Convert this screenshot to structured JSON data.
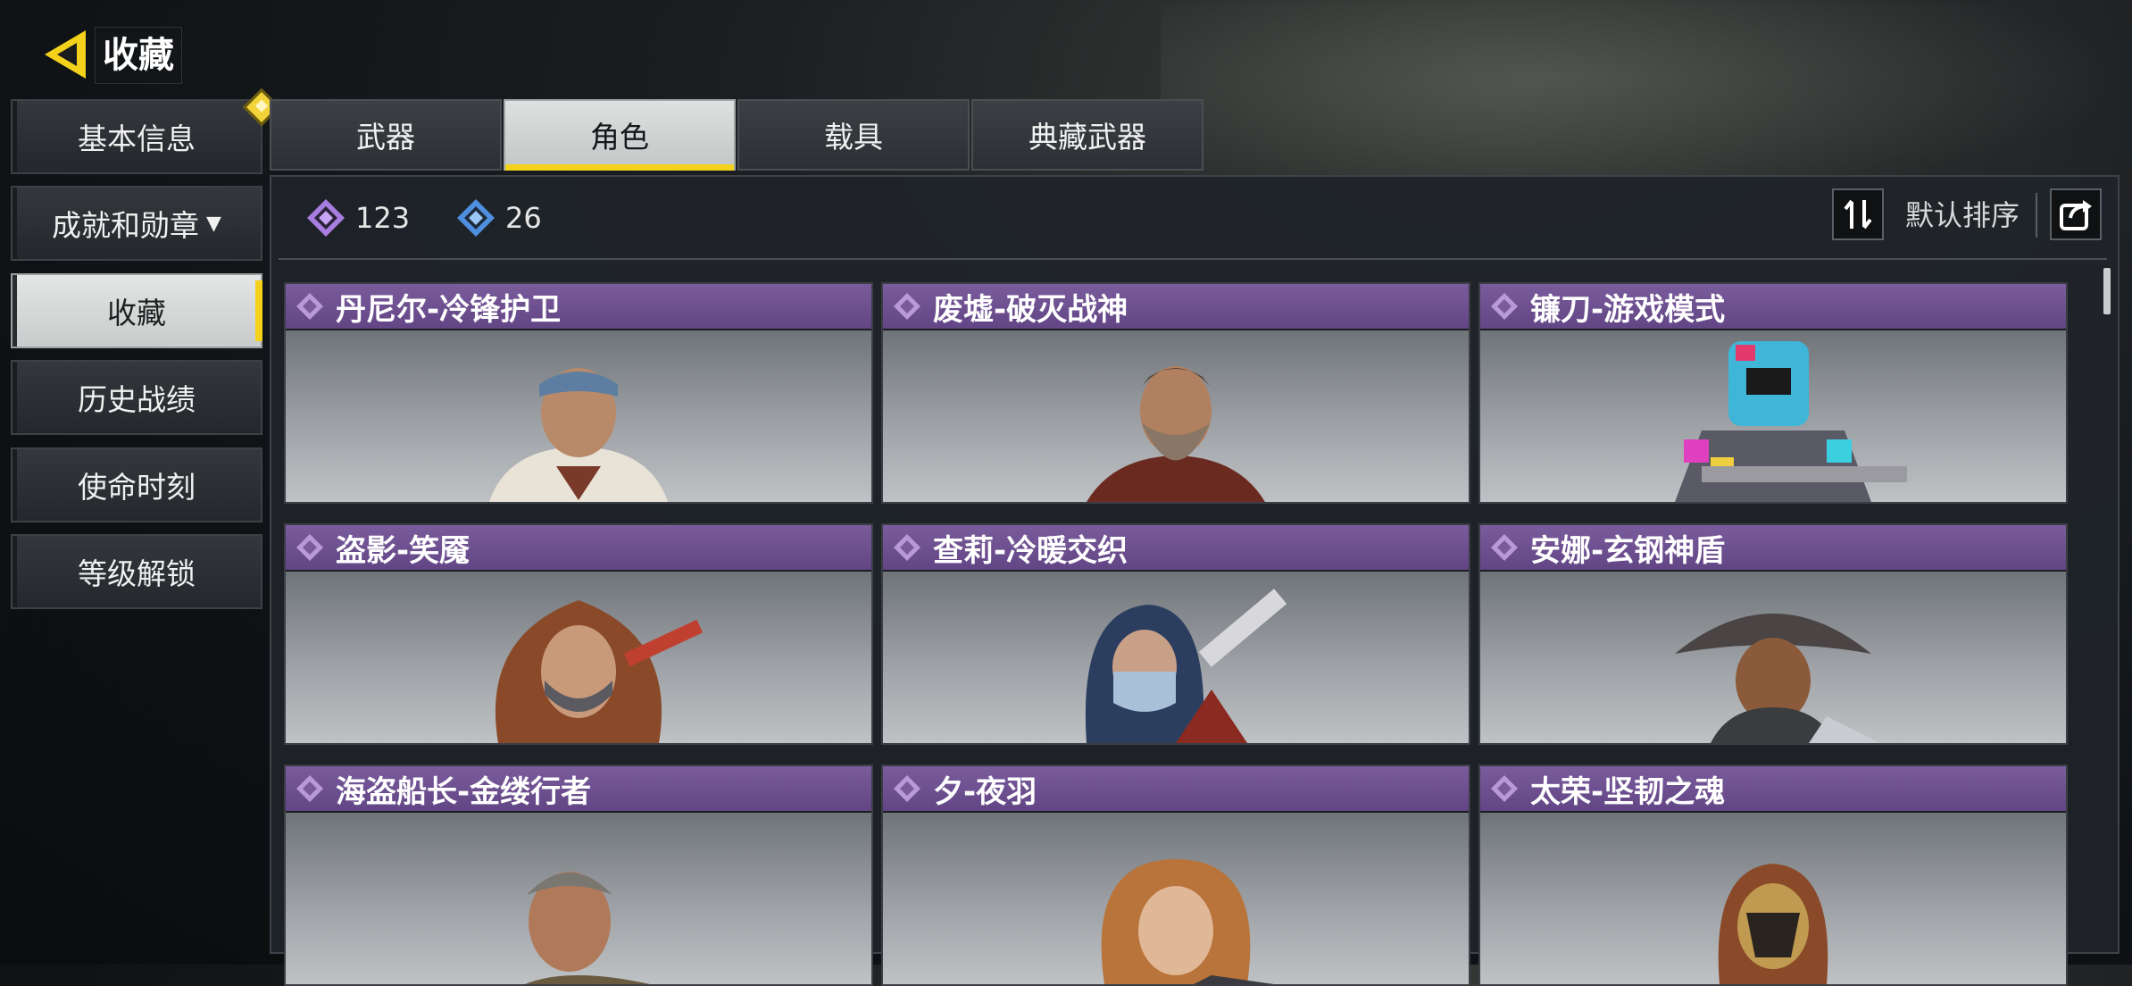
{
  "header": {
    "title": "收藏"
  },
  "sidebar": {
    "items": [
      {
        "label": "基本信息"
      },
      {
        "label": "成就和勋章"
      },
      {
        "label": "收藏"
      },
      {
        "label": "历史战绩"
      },
      {
        "label": "使命时刻"
      },
      {
        "label": "等级解锁"
      }
    ],
    "active_index": 2
  },
  "tabs": [
    {
      "label": "武器"
    },
    {
      "label": "角色"
    },
    {
      "label": "载具"
    },
    {
      "label": "典藏武器"
    }
  ],
  "active_tab_index": 1,
  "stats": {
    "purple_count": "123",
    "blue_count": "26"
  },
  "sort": {
    "label": "默认排序"
  },
  "cards": [
    {
      "name": "丹尼尔-冷锋护卫",
      "rarity_icon": "purple-diamond-icon"
    },
    {
      "name": "废墟-破灭战神",
      "rarity_icon": "purple-diamond-icon"
    },
    {
      "name": "镰刀-游戏模式",
      "rarity_icon": "purple-diamond-icon"
    },
    {
      "name": "盗影-笑魇",
      "rarity_icon": "purple-diamond-icon"
    },
    {
      "name": "查莉-冷暖交织",
      "rarity_icon": "purple-diamond-icon"
    },
    {
      "name": "安娜-玄钢神盾",
      "rarity_icon": "purple-diamond-icon"
    },
    {
      "name": "海盗船长-金缕行者",
      "rarity_icon": "purple-diamond-icon"
    },
    {
      "name": "夕-夜羽",
      "rarity_icon": "purple-diamond-icon"
    },
    {
      "name": "太荣-坚韧之魂",
      "rarity_icon": "purple-diamond-icon"
    }
  ],
  "colors": {
    "accent_yellow": "#f4d21c",
    "card_header_purple": "#6d4f90",
    "purple_diamond": "#a77de0",
    "blue_diamond": "#4f8fe0"
  }
}
